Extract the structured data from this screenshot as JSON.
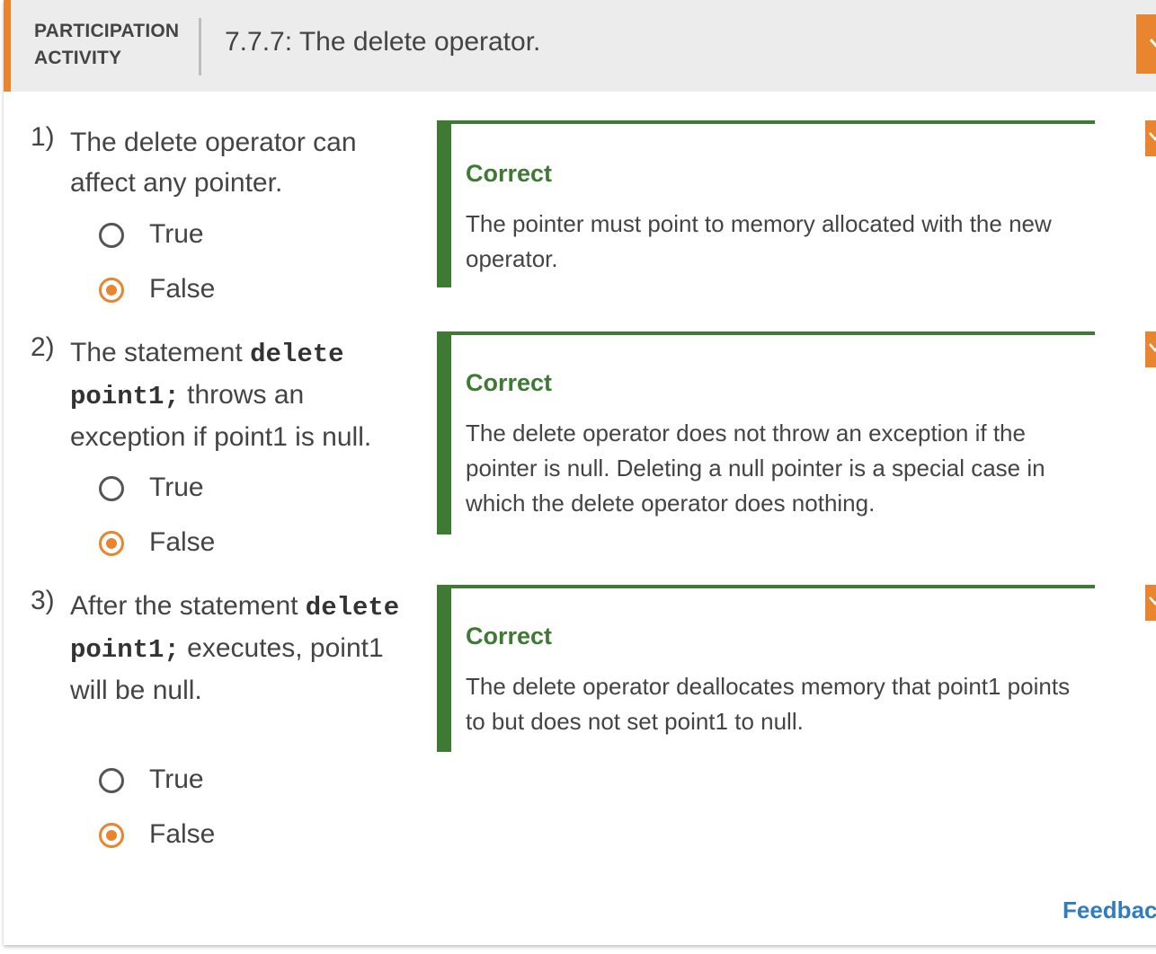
{
  "header": {
    "label_line1": "PARTICIPATION",
    "label_line2": "ACTIVITY",
    "title": "7.7.7: The delete operator.",
    "collapse_icon": "chevron-down-icon"
  },
  "colors": {
    "accent": "#e8852e",
    "correct": "#3f7a34",
    "link": "#2f7dc1"
  },
  "questions": [
    {
      "number": "1)",
      "text_parts": [
        "The delete operator can affect any pointer."
      ],
      "options": [
        "True",
        "False"
      ],
      "selected": "False",
      "feedback": {
        "title": "Correct",
        "text": "The pointer must point to memory allocated with the new operator."
      }
    },
    {
      "number": "2)",
      "text_before": "The statement ",
      "code": "delete point1;",
      "text_after": " throws an exception if point1 is null.",
      "options": [
        "True",
        "False"
      ],
      "selected": "False",
      "feedback": {
        "title": "Correct",
        "text": "The delete operator does not throw an exception if the pointer is null. Deleting a null pointer is a special case in which the delete operator does nothing."
      }
    },
    {
      "number": "3)",
      "text_before": "After the statement ",
      "code": "delete point1;",
      "text_after": " executes, point1 will be null.",
      "options": [
        "True",
        "False"
      ],
      "selected": "False",
      "feedback": {
        "title": "Correct",
        "text": "The delete operator deallocates memory that point1 points to but does not set point1 to null."
      }
    }
  ],
  "footer": {
    "feedback_link": "Feedback?"
  }
}
